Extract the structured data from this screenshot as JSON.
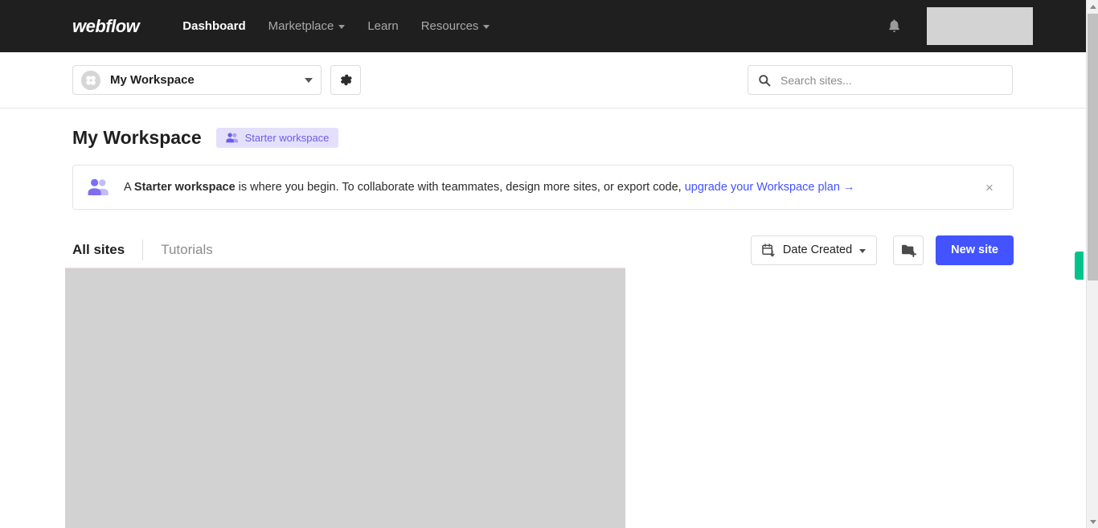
{
  "navbar": {
    "logo_text": "webflow",
    "links": [
      {
        "label": "Dashboard",
        "has_caret": false,
        "active": true
      },
      {
        "label": "Marketplace",
        "has_caret": true,
        "active": false
      },
      {
        "label": "Learn",
        "has_caret": false,
        "active": false
      },
      {
        "label": "Resources",
        "has_caret": true,
        "active": false
      }
    ],
    "notification_icon": "bell-icon",
    "background_color": "#1f1f1f"
  },
  "toolbar": {
    "workspace_selector": {
      "name": "My Workspace",
      "avatar_icon": "workspace-avatar-icon",
      "caret_icon": "chevron-down-icon"
    },
    "settings_icon": "gear-icon",
    "search": {
      "placeholder": "Search sites...",
      "value": "",
      "icon": "search-icon"
    }
  },
  "main": {
    "title": "My Workspace",
    "badge": {
      "label": "Starter workspace",
      "icon": "people-icon",
      "background_color": "#e4e0fb",
      "text_color": "#6c5ce7"
    },
    "banner": {
      "icon": "people-icon",
      "text_prefix": "A ",
      "text_bold": "Starter workspace",
      "text_middle": " is where you begin. To collaborate with teammates, design more sites, or export code, ",
      "link_text": "upgrade your Workspace plan →",
      "link_color": "#4353ff",
      "close_icon": "close-icon",
      "close_label": "×"
    },
    "tabs": [
      {
        "label": "All sites",
        "active": true
      },
      {
        "label": "Tutorials",
        "active": false
      }
    ],
    "actions": {
      "sort": {
        "label": "Date Created",
        "icon": "calendar-sort-icon",
        "caret_icon": "chevron-down-icon"
      },
      "new_folder_icon": "new-folder-icon",
      "new_site_label": "New site",
      "new_site_color": "#4353ff"
    },
    "site_card_placeholder": {
      "state": "loading",
      "color": "#d2d2d2"
    }
  },
  "widgets": {
    "feedback_tab": {
      "icon": "feedback-tab",
      "color": "#00c48c"
    },
    "scrollbar": {
      "up_arrow_icon": "scroll-up-arrow-icon",
      "down_arrow_icon": "scroll-down-arrow-icon",
      "thumb": "scrollbar-thumb"
    }
  }
}
